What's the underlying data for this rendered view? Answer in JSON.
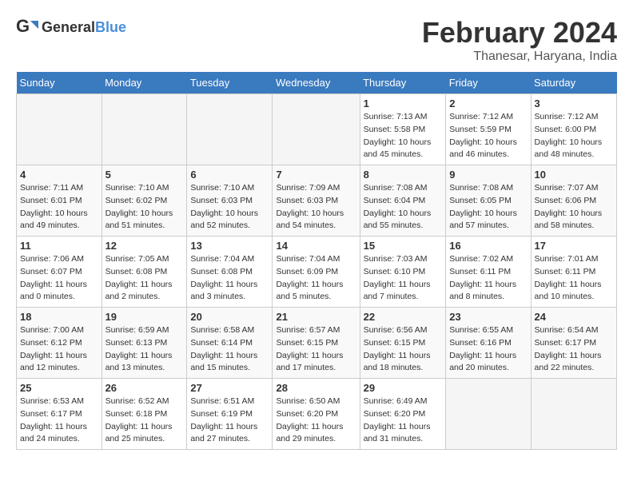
{
  "logo": {
    "text_general": "General",
    "text_blue": "Blue"
  },
  "title": "February 2024",
  "subtitle": "Thanesar, Haryana, India",
  "days_of_week": [
    "Sunday",
    "Monday",
    "Tuesday",
    "Wednesday",
    "Thursday",
    "Friday",
    "Saturday"
  ],
  "weeks": [
    [
      {
        "day": "",
        "info": ""
      },
      {
        "day": "",
        "info": ""
      },
      {
        "day": "",
        "info": ""
      },
      {
        "day": "",
        "info": ""
      },
      {
        "day": "1",
        "info": "Sunrise: 7:13 AM\nSunset: 5:58 PM\nDaylight: 10 hours and 45 minutes."
      },
      {
        "day": "2",
        "info": "Sunrise: 7:12 AM\nSunset: 5:59 PM\nDaylight: 10 hours and 46 minutes."
      },
      {
        "day": "3",
        "info": "Sunrise: 7:12 AM\nSunset: 6:00 PM\nDaylight: 10 hours and 48 minutes."
      }
    ],
    [
      {
        "day": "4",
        "info": "Sunrise: 7:11 AM\nSunset: 6:01 PM\nDaylight: 10 hours and 49 minutes."
      },
      {
        "day": "5",
        "info": "Sunrise: 7:10 AM\nSunset: 6:02 PM\nDaylight: 10 hours and 51 minutes."
      },
      {
        "day": "6",
        "info": "Sunrise: 7:10 AM\nSunset: 6:03 PM\nDaylight: 10 hours and 52 minutes."
      },
      {
        "day": "7",
        "info": "Sunrise: 7:09 AM\nSunset: 6:03 PM\nDaylight: 10 hours and 54 minutes."
      },
      {
        "day": "8",
        "info": "Sunrise: 7:08 AM\nSunset: 6:04 PM\nDaylight: 10 hours and 55 minutes."
      },
      {
        "day": "9",
        "info": "Sunrise: 7:08 AM\nSunset: 6:05 PM\nDaylight: 10 hours and 57 minutes."
      },
      {
        "day": "10",
        "info": "Sunrise: 7:07 AM\nSunset: 6:06 PM\nDaylight: 10 hours and 58 minutes."
      }
    ],
    [
      {
        "day": "11",
        "info": "Sunrise: 7:06 AM\nSunset: 6:07 PM\nDaylight: 11 hours and 0 minutes."
      },
      {
        "day": "12",
        "info": "Sunrise: 7:05 AM\nSunset: 6:08 PM\nDaylight: 11 hours and 2 minutes."
      },
      {
        "day": "13",
        "info": "Sunrise: 7:04 AM\nSunset: 6:08 PM\nDaylight: 11 hours and 3 minutes."
      },
      {
        "day": "14",
        "info": "Sunrise: 7:04 AM\nSunset: 6:09 PM\nDaylight: 11 hours and 5 minutes."
      },
      {
        "day": "15",
        "info": "Sunrise: 7:03 AM\nSunset: 6:10 PM\nDaylight: 11 hours and 7 minutes."
      },
      {
        "day": "16",
        "info": "Sunrise: 7:02 AM\nSunset: 6:11 PM\nDaylight: 11 hours and 8 minutes."
      },
      {
        "day": "17",
        "info": "Sunrise: 7:01 AM\nSunset: 6:11 PM\nDaylight: 11 hours and 10 minutes."
      }
    ],
    [
      {
        "day": "18",
        "info": "Sunrise: 7:00 AM\nSunset: 6:12 PM\nDaylight: 11 hours and 12 minutes."
      },
      {
        "day": "19",
        "info": "Sunrise: 6:59 AM\nSunset: 6:13 PM\nDaylight: 11 hours and 13 minutes."
      },
      {
        "day": "20",
        "info": "Sunrise: 6:58 AM\nSunset: 6:14 PM\nDaylight: 11 hours and 15 minutes."
      },
      {
        "day": "21",
        "info": "Sunrise: 6:57 AM\nSunset: 6:15 PM\nDaylight: 11 hours and 17 minutes."
      },
      {
        "day": "22",
        "info": "Sunrise: 6:56 AM\nSunset: 6:15 PM\nDaylight: 11 hours and 18 minutes."
      },
      {
        "day": "23",
        "info": "Sunrise: 6:55 AM\nSunset: 6:16 PM\nDaylight: 11 hours and 20 minutes."
      },
      {
        "day": "24",
        "info": "Sunrise: 6:54 AM\nSunset: 6:17 PM\nDaylight: 11 hours and 22 minutes."
      }
    ],
    [
      {
        "day": "25",
        "info": "Sunrise: 6:53 AM\nSunset: 6:17 PM\nDaylight: 11 hours and 24 minutes."
      },
      {
        "day": "26",
        "info": "Sunrise: 6:52 AM\nSunset: 6:18 PM\nDaylight: 11 hours and 25 minutes."
      },
      {
        "day": "27",
        "info": "Sunrise: 6:51 AM\nSunset: 6:19 PM\nDaylight: 11 hours and 27 minutes."
      },
      {
        "day": "28",
        "info": "Sunrise: 6:50 AM\nSunset: 6:20 PM\nDaylight: 11 hours and 29 minutes."
      },
      {
        "day": "29",
        "info": "Sunrise: 6:49 AM\nSunset: 6:20 PM\nDaylight: 11 hours and 31 minutes."
      },
      {
        "day": "",
        "info": ""
      },
      {
        "day": "",
        "info": ""
      }
    ]
  ]
}
